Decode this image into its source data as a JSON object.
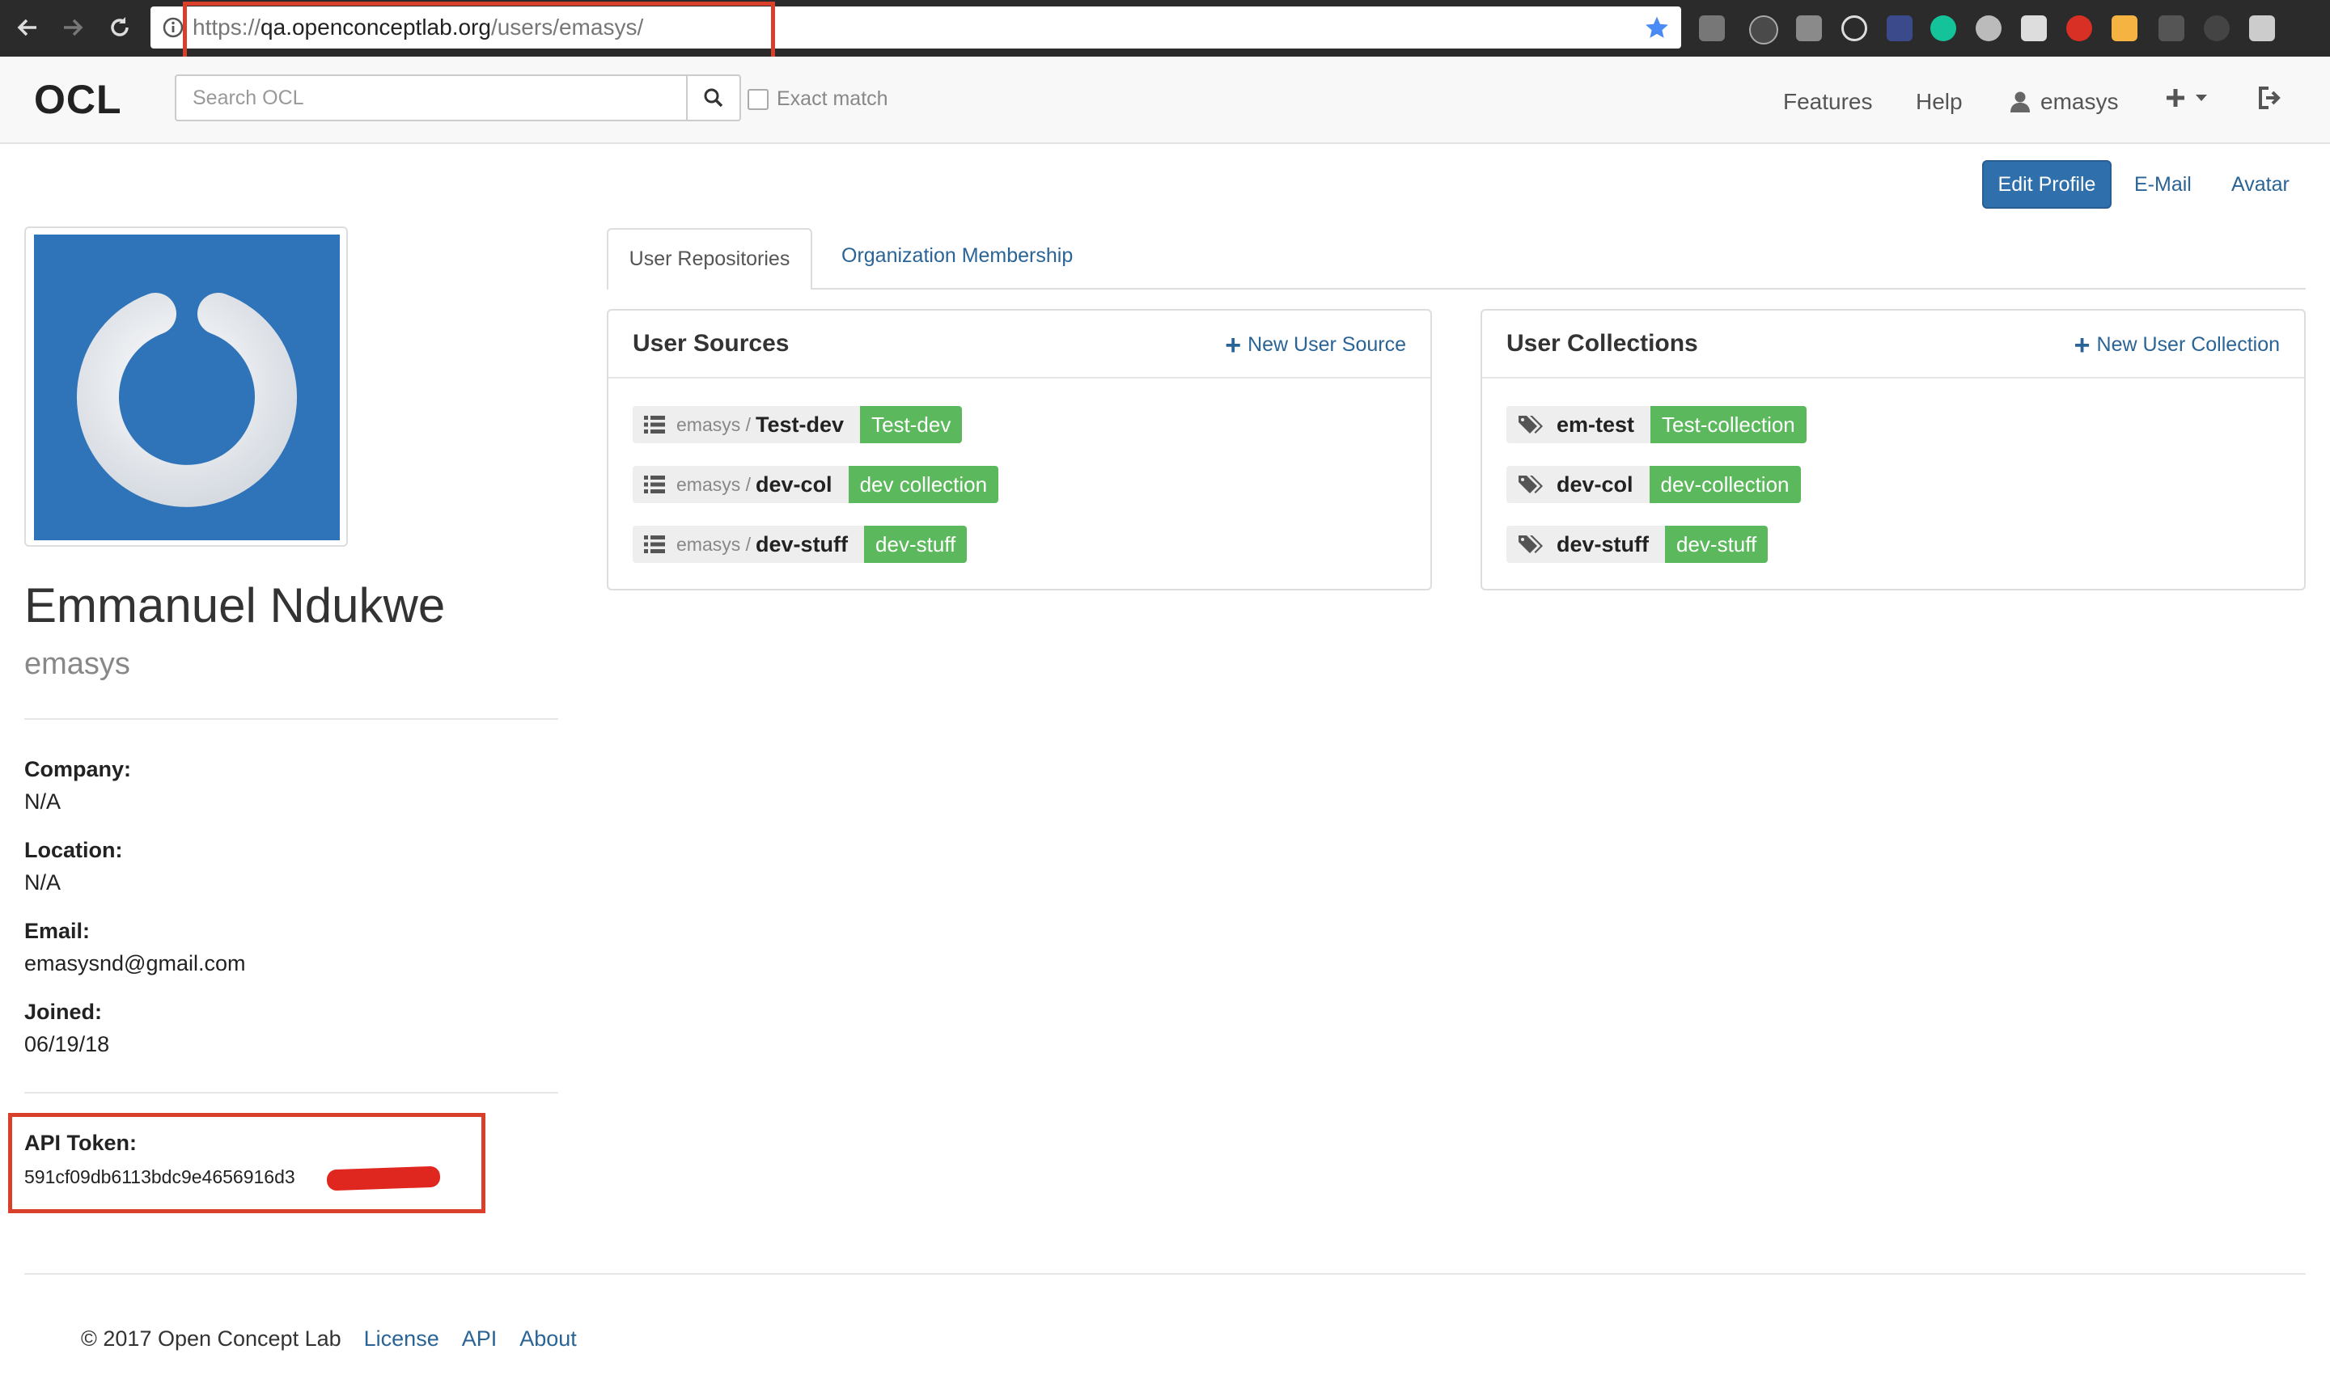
{
  "browser": {
    "url_scheme": "https://",
    "url_host": "qa.openconceptlab.org",
    "url_path": "/users/emasys/"
  },
  "navbar": {
    "brand": "OCL",
    "search_placeholder": "Search OCL",
    "exact_match_label": "Exact match",
    "links": [
      "Features",
      "Help"
    ],
    "user": "emasys"
  },
  "profile_actions": {
    "edit_profile": "Edit Profile",
    "email": "E-Mail",
    "avatar": "Avatar"
  },
  "profile": {
    "full_name": "Emmanuel Ndukwe",
    "username": "emasys",
    "company_label": "Company:",
    "company": "N/A",
    "location_label": "Location:",
    "location": "N/A",
    "email_label": "Email:",
    "email": "emasysnd@gmail.com",
    "joined_label": "Joined:",
    "joined": "06/19/18",
    "api_token_label": "API Token:",
    "api_token_visible": "591cf09db6113bdc9e4656916d3"
  },
  "tabs": {
    "active": "User Repositories",
    "other": "Organization Membership"
  },
  "user_sources": {
    "title": "User Sources",
    "add_label": "New User Source",
    "items": [
      {
        "owner": "emasys",
        "name": "Test-dev",
        "label": "Test-dev"
      },
      {
        "owner": "emasys",
        "name": "dev-col",
        "label": "dev collection"
      },
      {
        "owner": "emasys",
        "name": "dev-stuff",
        "label": "dev-stuff"
      }
    ]
  },
  "user_collections": {
    "title": "User Collections",
    "add_label": "New User Collection",
    "items": [
      {
        "name": "em-test",
        "label": "Test-collection"
      },
      {
        "name": "dev-col",
        "label": "dev-collection"
      },
      {
        "name": "dev-stuff",
        "label": "dev-stuff"
      }
    ]
  },
  "footer": {
    "copyright": "© 2017 Open Concept Lab",
    "links": [
      "License",
      "API",
      "About"
    ]
  },
  "colors": {
    "primary": "#2f6fab",
    "label_green": "#5cb85c",
    "link": "#2a6496",
    "annotation_red": "#d9402b",
    "avatar_bg": "#2f73b8"
  }
}
